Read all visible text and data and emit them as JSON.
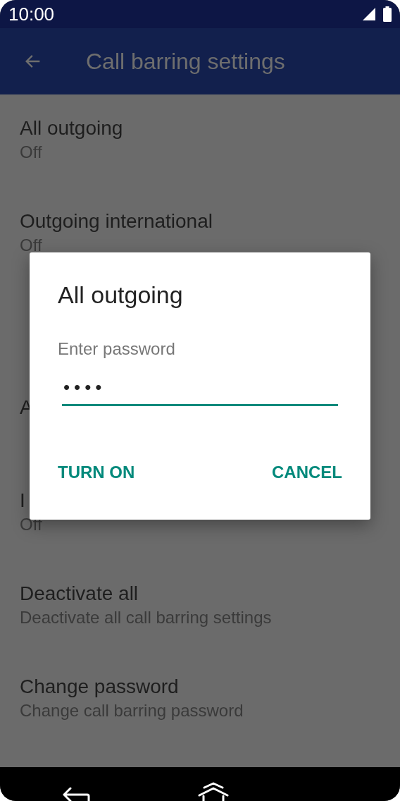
{
  "status_bar": {
    "time": "10:00"
  },
  "app_bar": {
    "title": "Call barring settings"
  },
  "settings": [
    {
      "kind": "setting",
      "title": "All outgoing",
      "summary": "Off"
    },
    {
      "kind": "setting",
      "title": "Outgoing international",
      "summary": "Off"
    },
    {
      "kind": "covered"
    },
    {
      "kind": "setting",
      "title": "A"
    },
    {
      "kind": "setting",
      "title": "I",
      "summary": "Off"
    },
    {
      "kind": "setting",
      "title": "Deactivate all",
      "summary": "Deactivate all call barring settings"
    },
    {
      "kind": "setting",
      "title": "Change password",
      "summary": "Change call barring password"
    }
  ],
  "dialog": {
    "title": "All outgoing",
    "field": {
      "label": "Enter password",
      "value": "••••"
    },
    "buttons": [
      {
        "label": "TURN ON"
      },
      {
        "label": "CANCEL"
      }
    ]
  }
}
